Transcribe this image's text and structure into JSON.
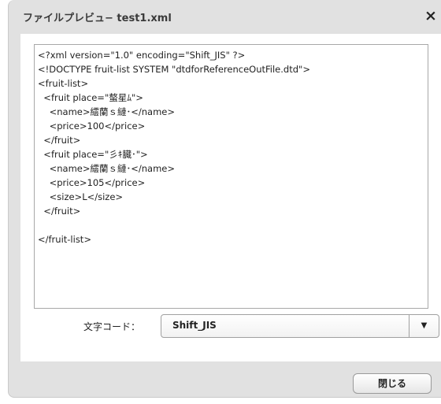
{
  "dialog": {
    "title": "ファイルプレビュ− test1.xml",
    "close_icon": "×",
    "close_button_label": "閉じる"
  },
  "xml_content": {
    "lines": [
      "<?xml version=\"1.0\" encoding=\"Shift_JIS\" ?>",
      "<!DOCTYPE fruit-list SYSTEM \"dtdforReferenceOutFile.dtd\">",
      "<fruit-list>",
      "  <fruit place=\"螯星ﾑ\">",
      "    <name>繧蘭ｓ縺･</name>",
      "    <price>100</price>",
      "  </fruit>",
      "  <fruit place=\"彡ｷ臓･\">",
      "    <name>繧蘭ｓ縺･</name>",
      "    <price>105</price>",
      "    <size>L</size>",
      "  </fruit>",
      "",
      "</fruit-list>"
    ]
  },
  "encoding": {
    "label": "文字コード：",
    "selected_value": "Shift_JIS",
    "dropdown_icon": "▼"
  },
  "colors": {
    "dialog_bg": "#e1e1e1",
    "panel_bg": "#ffffff",
    "border": "#a8a8a8",
    "text": "#222222"
  }
}
